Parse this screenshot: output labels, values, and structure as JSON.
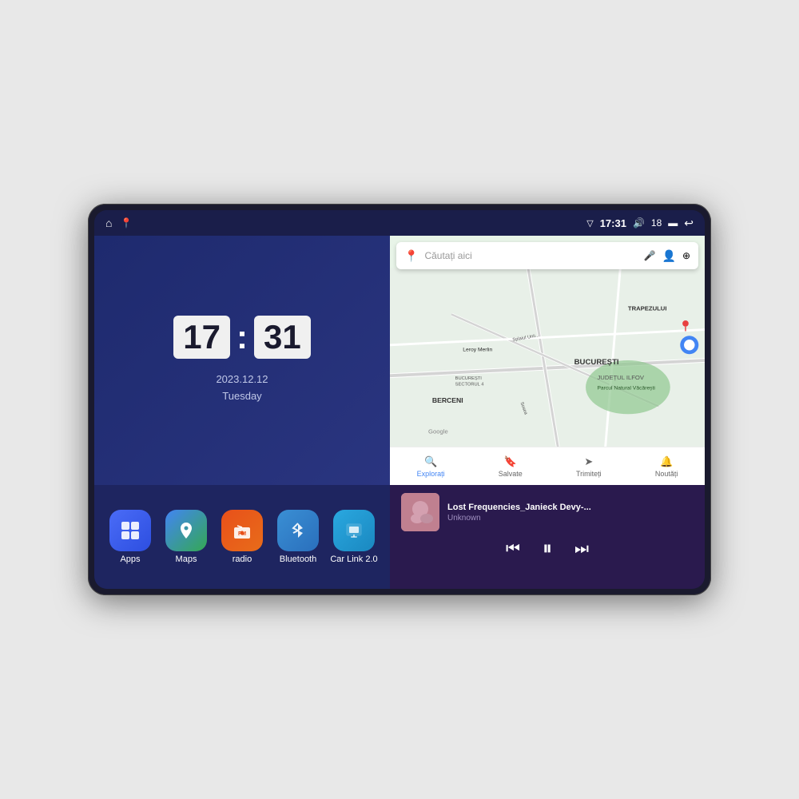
{
  "device": {
    "statusBar": {
      "leftIcons": [
        "home-icon",
        "maps-pin-icon"
      ],
      "signal": "▽",
      "time": "17:31",
      "volume": "🔊",
      "batteryLevel": "18",
      "battery": "🔋",
      "back": "↩"
    },
    "clock": {
      "hours": "17",
      "minutes": "31",
      "date": "2023.12.12",
      "day": "Tuesday"
    },
    "apps": [
      {
        "id": "apps",
        "label": "Apps",
        "iconClass": "icon-apps",
        "icon": "⊞"
      },
      {
        "id": "maps",
        "label": "Maps",
        "iconClass": "icon-maps",
        "icon": "📍"
      },
      {
        "id": "radio",
        "label": "radio",
        "iconClass": "icon-radio",
        "icon": "📻"
      },
      {
        "id": "bluetooth",
        "label": "Bluetooth",
        "iconClass": "icon-bluetooth",
        "icon": "⚡"
      },
      {
        "id": "carlink",
        "label": "Car Link 2.0",
        "iconClass": "icon-carlink",
        "icon": "📱"
      }
    ],
    "map": {
      "searchPlaceholder": "Căutați aici",
      "navItems": [
        {
          "label": "Explorați",
          "active": true,
          "icon": "🔍"
        },
        {
          "label": "Salvate",
          "active": false,
          "icon": "🔖"
        },
        {
          "label": "Trimiteți",
          "active": false,
          "icon": "➤"
        },
        {
          "label": "Noutăți",
          "active": false,
          "icon": "🔔"
        }
      ],
      "locations": [
        "TRAPEZULUI",
        "BUCUREȘTI",
        "JUDEȚUL ILFOV",
        "BERCENI",
        "Parcul Natural Văcărești",
        "Leroy Merlin",
        "BUCUREȘTI SECTORUL 4"
      ]
    },
    "music": {
      "title": "Lost Frequencies_Janieck Devy-...",
      "artist": "Unknown",
      "controls": {
        "prev": "⏮",
        "play": "⏸",
        "next": "⏭"
      }
    }
  }
}
